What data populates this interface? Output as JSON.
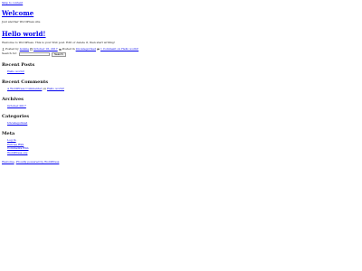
{
  "skip_link": "Skip to content",
  "site": {
    "title": "Welcome",
    "tagline": "Just another WordPress site"
  },
  "post": {
    "title": "Hello world!",
    "content": "Welcome to WordPress. This is your first post. Edit or delete it, then start writing!",
    "posted_by_label": "Posted by",
    "author": "bonnie",
    "date": "October 16, 2017",
    "posted_in_label": "Posted in",
    "category": "Uncategorized",
    "comment_link": "1 Comment on Hello world!"
  },
  "search": {
    "label": "Search for:",
    "value": "",
    "placeholder": "",
    "button": "Search"
  },
  "widgets": {
    "recent_posts": {
      "title": "Recent Posts",
      "items": [
        "Hello world!"
      ]
    },
    "recent_comments": {
      "title": "Recent Comments",
      "commenter": "A WordPress Commenter",
      "on_text": "on",
      "post": "Hello world!"
    },
    "archives": {
      "title": "Archives",
      "items": [
        "October 2017"
      ]
    },
    "categories": {
      "title": "Categories",
      "items": [
        "Uncategorized"
      ]
    },
    "meta": {
      "title": "Meta",
      "items": [
        "Log in",
        "Entries RSS",
        "Comments RSS",
        "WordPress.org"
      ]
    }
  },
  "footer": {
    "site_link": "Welcome",
    "powered_text": "Proudly powered by WordPress"
  },
  "icons": {
    "author": "user-icon",
    "date": "calendar-icon",
    "category": "folder-icon",
    "comments": "comment-icon"
  },
  "colors": {
    "link": "#0000ee",
    "background": "#ffffff",
    "text": "#111111"
  }
}
